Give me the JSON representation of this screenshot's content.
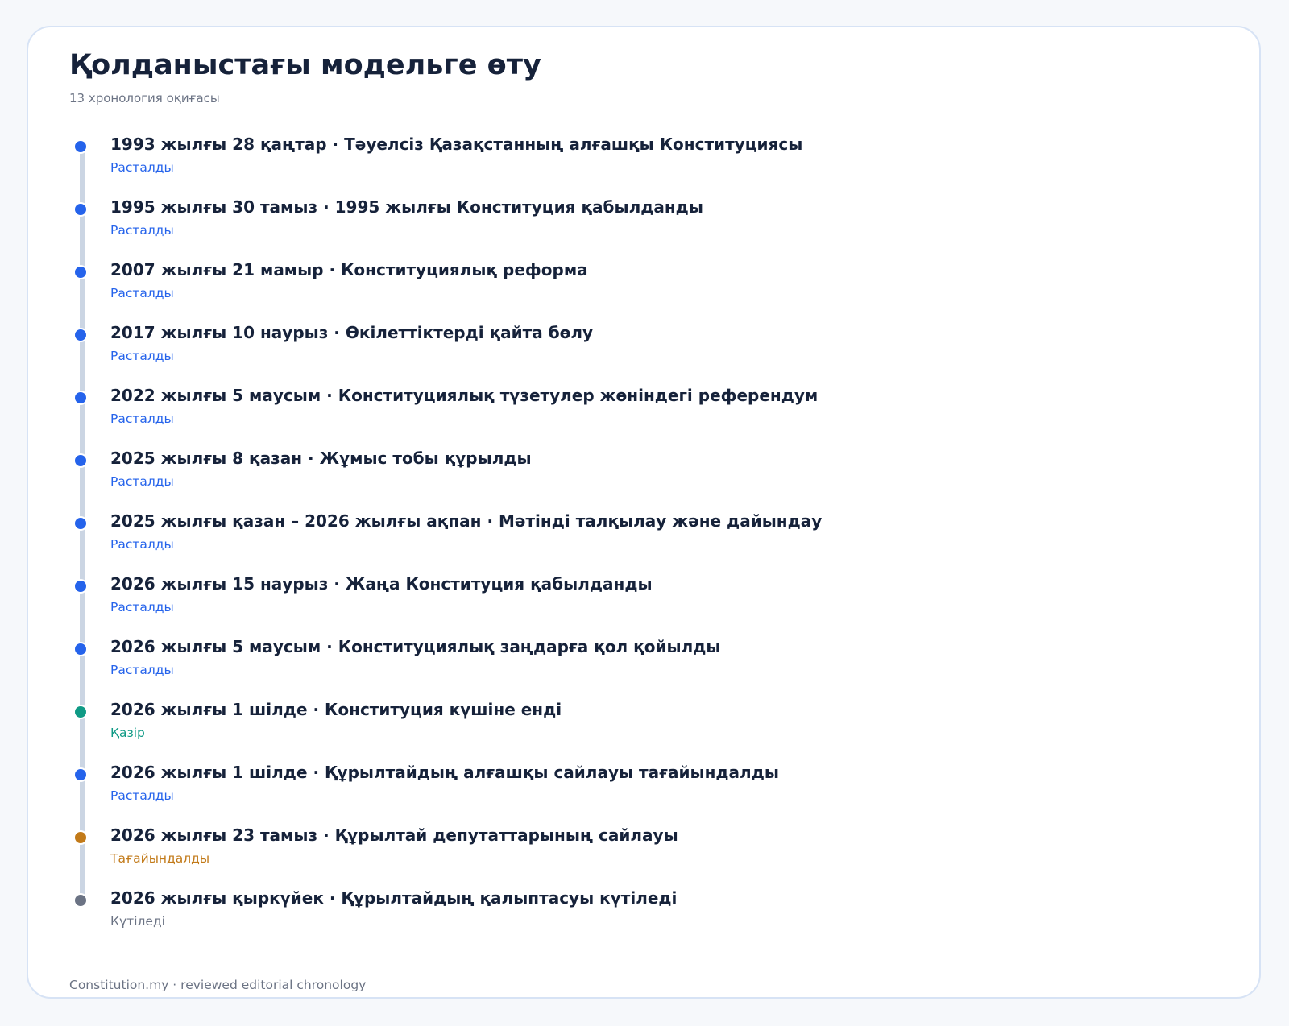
{
  "title": "Қолданыстағы модельге өту",
  "subtitle": "13 хронология оқиғасы",
  "colors": {
    "confirmed": "#2563eb",
    "current": "#0f9a85",
    "scheduled": "#c27a19",
    "pending": "#6b7384"
  },
  "events": [
    {
      "heading": "1993 жылғы 28 қаңтар · Тәуелсіз Қазақстанның алғашқы Конституциясы",
      "status": "Расталды",
      "kind": "confirmed"
    },
    {
      "heading": "1995 жылғы 30 тамыз · 1995 жылғы Конституция қабылданды",
      "status": "Расталды",
      "kind": "confirmed"
    },
    {
      "heading": "2007 жылғы 21 мамыр · Конституциялық реформа",
      "status": "Расталды",
      "kind": "confirmed"
    },
    {
      "heading": "2017 жылғы 10 наурыз · Өкілеттіктерді қайта бөлу",
      "status": "Расталды",
      "kind": "confirmed"
    },
    {
      "heading": "2022 жылғы 5 маусым · Конституциялық түзетулер жөніндегі референдум",
      "status": "Расталды",
      "kind": "confirmed"
    },
    {
      "heading": "2025 жылғы 8 қазан · Жұмыс тобы құрылды",
      "status": "Расталды",
      "kind": "confirmed"
    },
    {
      "heading": "2025 жылғы қазан – 2026 жылғы ақпан · Мәтінді талқылау және дайындау",
      "status": "Расталды",
      "kind": "confirmed"
    },
    {
      "heading": "2026 жылғы 15 наурыз · Жаңа Конституция қабылданды",
      "status": "Расталды",
      "kind": "confirmed"
    },
    {
      "heading": "2026 жылғы 5 маусым · Конституциялық заңдарға қол қойылды",
      "status": "Расталды",
      "kind": "confirmed"
    },
    {
      "heading": "2026 жылғы 1 шілде · Конституция күшіне енді",
      "status": "Қазір",
      "kind": "current"
    },
    {
      "heading": "2026 жылғы 1 шілде · Құрылтайдың алғашқы сайлауы тағайындалды",
      "status": "Расталды",
      "kind": "confirmed"
    },
    {
      "heading": "2026 жылғы 23 тамыз · Құрылтай депутаттарының сайлауы",
      "status": "Тағайындалды",
      "kind": "scheduled"
    },
    {
      "heading": "2026 жылғы қыркүйек · Құрылтайдың қалыптасуы күтіледі",
      "status": "Күтіледі",
      "kind": "pending"
    }
  ],
  "footer": "Constitution.my · reviewed editorial chronology"
}
